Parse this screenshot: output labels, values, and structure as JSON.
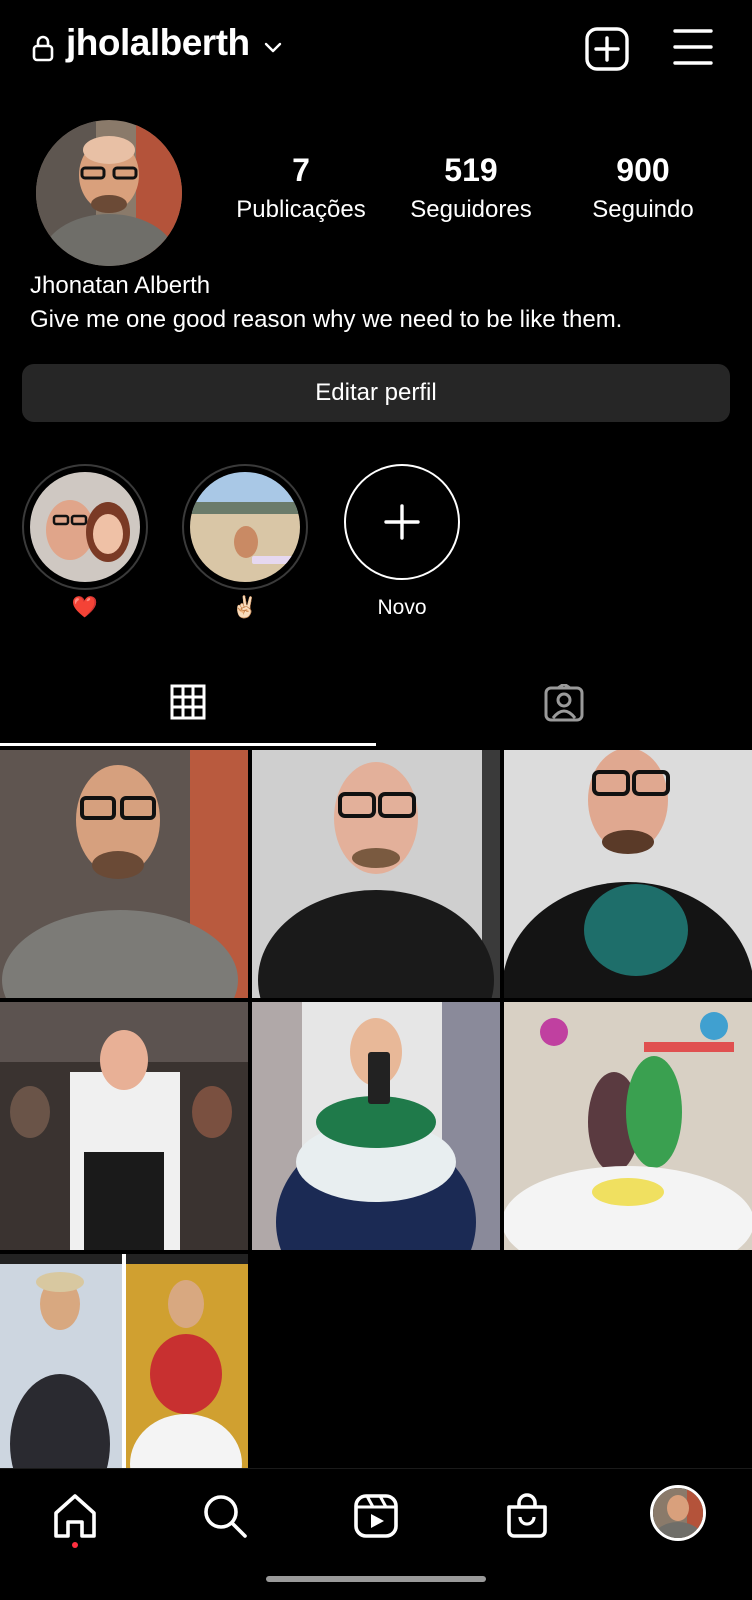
{
  "header": {
    "username": "jholalberth",
    "icons": [
      "lock-icon",
      "chevron-down-icon",
      "add-post-icon",
      "menu-icon"
    ]
  },
  "profile": {
    "full_name": "Jhonatan Alberth",
    "bio": "Give me one good reason why we need to be like them.",
    "stats": [
      {
        "value": "7",
        "label": "Publicações"
      },
      {
        "value": "519",
        "label": "Seguidores"
      },
      {
        "value": "900",
        "label": "Seguindo"
      }
    ],
    "edit_button": "Editar perfil"
  },
  "highlights": [
    {
      "label": "❤️"
    },
    {
      "label": "✌🏻"
    },
    {
      "label": "Novo"
    }
  ],
  "tabs": [
    {
      "icon": "grid-icon",
      "active": true
    },
    {
      "icon": "tagged-icon",
      "active": false
    }
  ],
  "colors": {
    "background": "#000000",
    "button": "#262626",
    "notification_dot": "#ff3040"
  },
  "bottom_nav": [
    "home-icon",
    "search-icon",
    "reels-icon",
    "shop-icon",
    "profile-avatar"
  ]
}
